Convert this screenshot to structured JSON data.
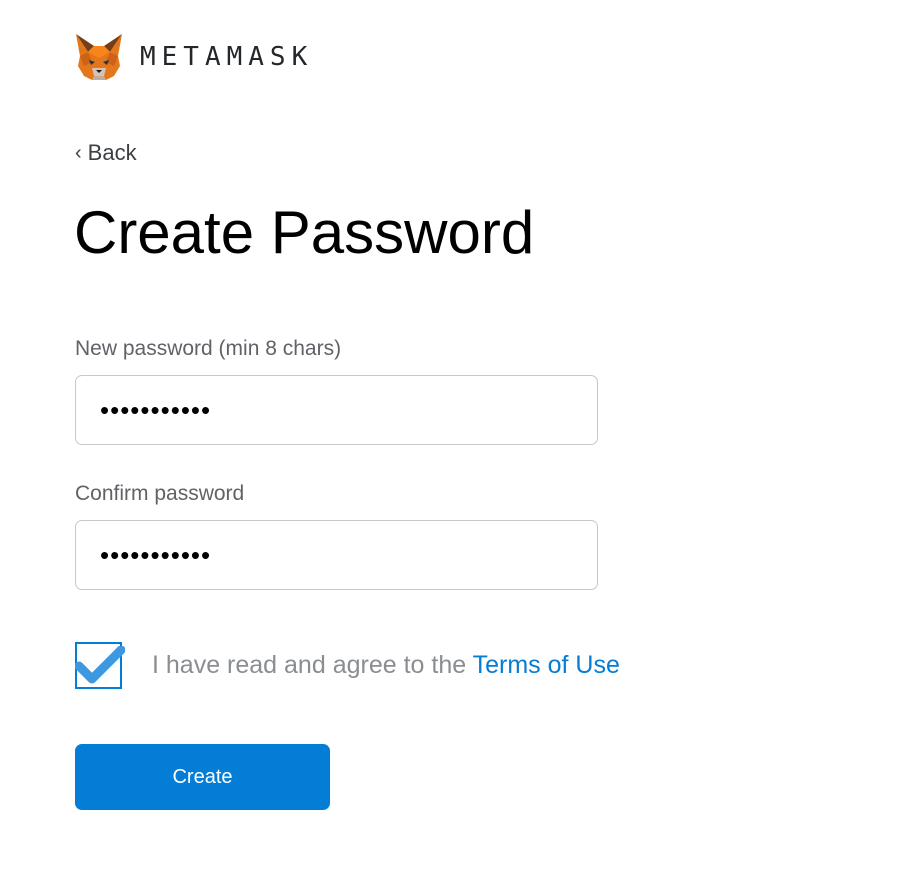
{
  "header": {
    "brand_name": "METAMASK",
    "logo_icon": "metamask-fox-icon"
  },
  "navigation": {
    "back_chevron": "‹",
    "back_label": "Back"
  },
  "page": {
    "title": "Create Password"
  },
  "form": {
    "new_password_label": "New password (min 8 chars)",
    "new_password_value": "•••••••••••",
    "confirm_password_label": "Confirm password",
    "confirm_password_value": "•••••••••••"
  },
  "terms": {
    "checked": true,
    "prefix_text": "I have read and agree to the ",
    "link_text": "Terms of Use"
  },
  "actions": {
    "create_label": "Create"
  },
  "colors": {
    "accent": "#037dd6",
    "checkmark": "#3d98e0",
    "fox_orange": "#e2761b"
  }
}
